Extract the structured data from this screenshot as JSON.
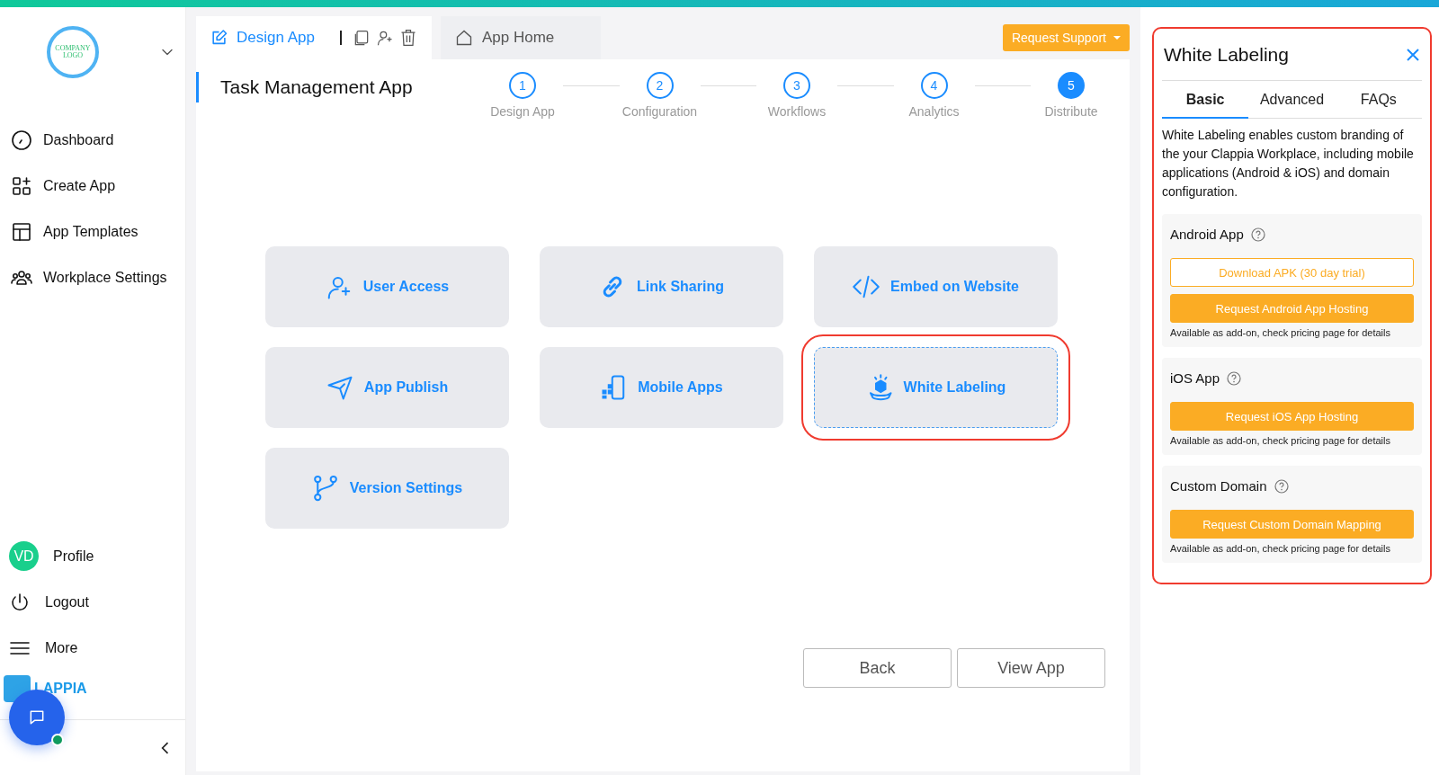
{
  "sidebar": {
    "logo": {
      "line_1": "COMPANY",
      "line_2": "LOGO"
    },
    "items": [
      {
        "label": "Dashboard",
        "kind": "gauge",
        "selected": false
      },
      {
        "label": "Create App",
        "kind": "grid-plus",
        "selected": false
      },
      {
        "label": "App Templates",
        "kind": "template",
        "selected": false
      },
      {
        "label": "Workplace Settings",
        "kind": "people",
        "selected": false
      }
    ],
    "bottom_items": [
      {
        "label": "Profile",
        "kind": "avatar",
        "initials": "VD"
      },
      {
        "label": "Logout",
        "kind": "power"
      },
      {
        "label": "More",
        "kind": "menu"
      }
    ],
    "brand": "LAPPIA"
  },
  "header": {
    "tabs": [
      {
        "label": "Design App",
        "selected": true
      },
      {
        "label": "App Home",
        "selected": false
      }
    ],
    "support_button": "Request Support"
  },
  "app_title": "Task Management App",
  "steps": [
    {
      "number": "1",
      "label": "Design App",
      "active": false
    },
    {
      "number": "2",
      "label": "Configuration",
      "active": false
    },
    {
      "number": "3",
      "label": "Workflows",
      "active": false
    },
    {
      "number": "4",
      "label": "Analytics",
      "active": false
    },
    {
      "number": "5",
      "label": "Distribute",
      "active": true
    }
  ],
  "options": [
    {
      "label": "User Access",
      "kind": "user-plus",
      "selected": false
    },
    {
      "label": "Link Sharing",
      "kind": "link",
      "selected": false
    },
    {
      "label": "Embed on Website",
      "kind": "code",
      "selected": false
    },
    {
      "label": "App Publish",
      "kind": "send",
      "selected": false
    },
    {
      "label": "Mobile Apps",
      "kind": "phone",
      "selected": false
    },
    {
      "label": "White Labeling",
      "kind": "box",
      "selected": true
    },
    {
      "label": "Version Settings",
      "kind": "branch",
      "selected": false
    }
  ],
  "footer_buttons": [
    "Back",
    "View App"
  ],
  "panel": {
    "title": "White Labeling",
    "highlighted": true,
    "tabs": [
      {
        "label": "Basic",
        "selected": true
      },
      {
        "label": "Advanced",
        "selected": false
      },
      {
        "label": "FAQs",
        "selected": false
      }
    ],
    "description": "White Labeling enables custom branding of the your Clappia Workplace, including mobile applications (Android & iOS) and domain configuration.",
    "sections": [
      {
        "title": "Android App",
        "buttons": [
          {
            "label": "Download APK (30 day trial)",
            "kind": "outline"
          },
          {
            "label": "Request Android App Hosting",
            "kind": "filled"
          }
        ],
        "note": "Available as add-on, check pricing page for details"
      },
      {
        "title": "iOS App",
        "buttons": [
          {
            "label": "Request iOS App Hosting",
            "kind": "filled"
          }
        ],
        "note": "Available as add-on, check pricing page for details"
      },
      {
        "title": "Custom Domain",
        "buttons": [
          {
            "label": "Request Custom Domain Mapping",
            "kind": "filled"
          }
        ],
        "note": "Available as add-on, check pricing page for details"
      }
    ]
  }
}
